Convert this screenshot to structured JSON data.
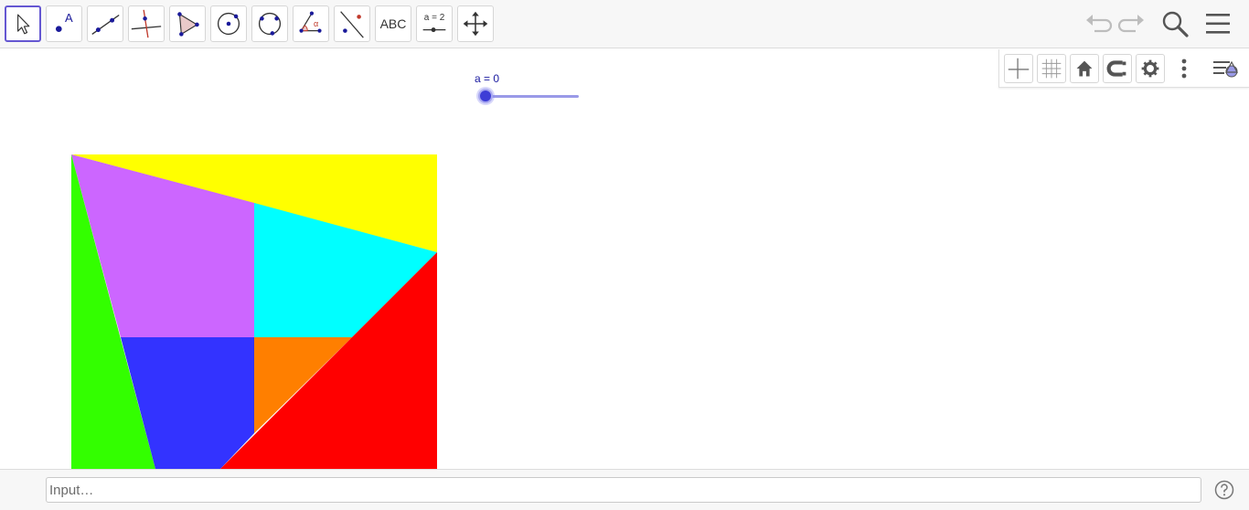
{
  "toolbar": {
    "tools": [
      {
        "id": "move",
        "label": ""
      },
      {
        "id": "point",
        "label": "A"
      },
      {
        "id": "line",
        "label": ""
      },
      {
        "id": "perpendicular",
        "label": ""
      },
      {
        "id": "polygon",
        "label": ""
      },
      {
        "id": "circle-center",
        "label": ""
      },
      {
        "id": "circle-three-points",
        "label": ""
      },
      {
        "id": "angle",
        "label": "α"
      },
      {
        "id": "reflect",
        "label": ""
      },
      {
        "id": "text",
        "label": "ABC"
      },
      {
        "id": "slider",
        "label": "a = 2"
      },
      {
        "id": "move-view",
        "label": ""
      }
    ],
    "selected_tool": "move",
    "accent_color": "#6557d2"
  },
  "slider": {
    "label": "a = 0",
    "value": 0
  },
  "shapes": {
    "colors": {
      "yellow": "#ffff00",
      "purple": "#cc66ff",
      "cyan": "#00ffff",
      "green": "#33ff00",
      "blue": "#3333ff",
      "orange": "#ff7f00",
      "red": "#ff0000"
    }
  },
  "input_bar": {
    "placeholder": "Input…"
  }
}
